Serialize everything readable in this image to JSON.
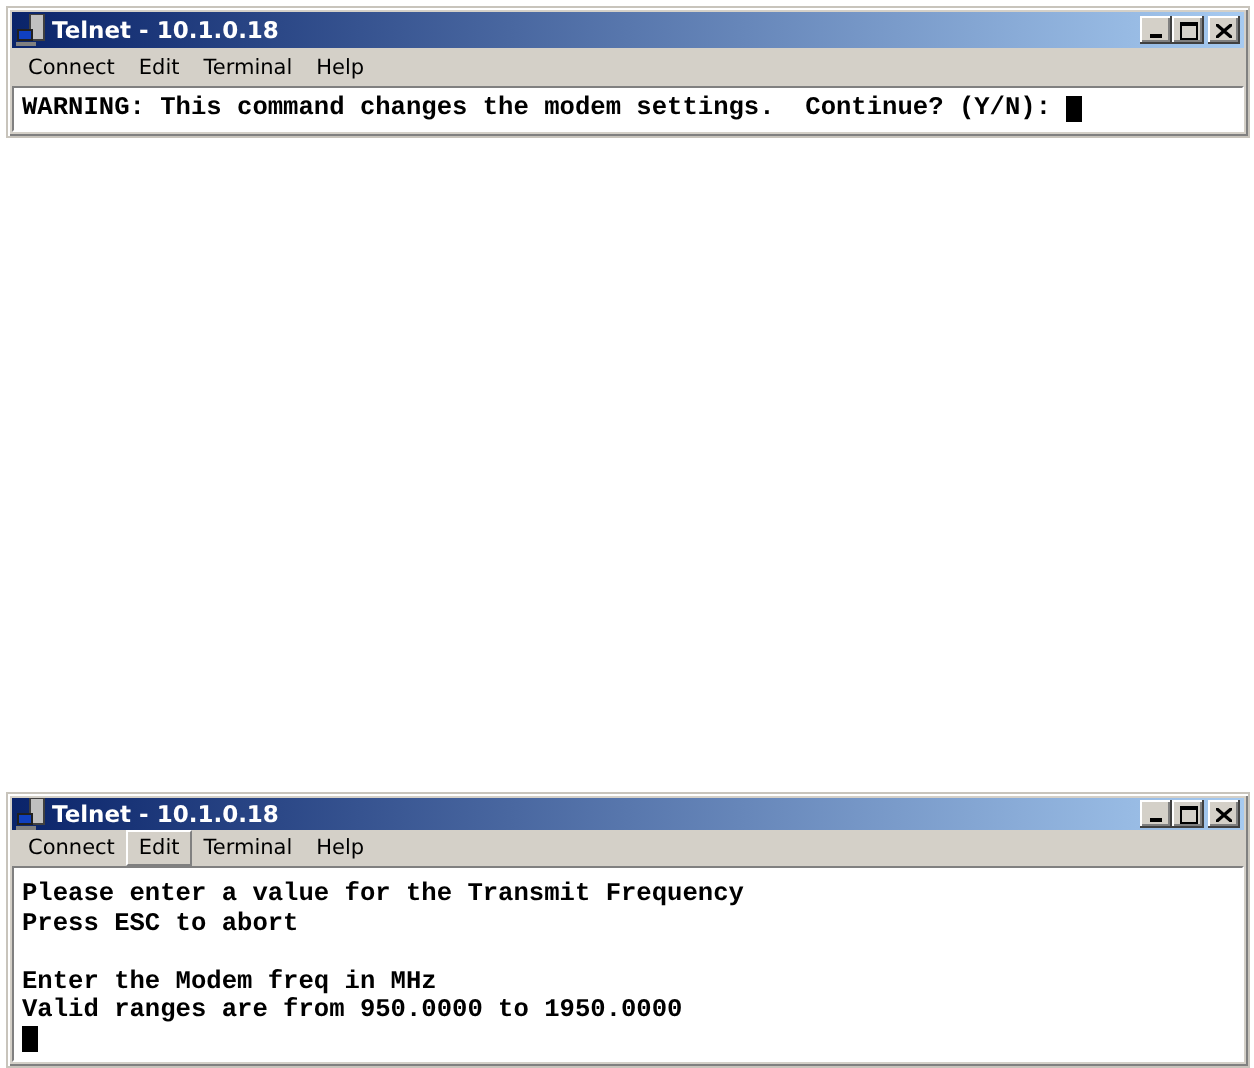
{
  "windows": [
    {
      "title": "Telnet - 10.1.0.18",
      "menu": [
        {
          "label": "Connect",
          "selected": false
        },
        {
          "label": "Edit",
          "selected": false
        },
        {
          "label": "Terminal",
          "selected": false
        },
        {
          "label": "Help",
          "selected": false
        }
      ],
      "terminal": {
        "lines": [
          {
            "kind": "text",
            "text": "WARNING: This command changes the modem settings.  Continue? (Y/N): ",
            "cursor": true
          }
        ]
      }
    },
    {
      "title": "Telnet - 10.1.0.18",
      "menu": [
        {
          "label": "Connect",
          "selected": false
        },
        {
          "label": "Edit",
          "selected": true
        },
        {
          "label": "Terminal",
          "selected": false
        },
        {
          "label": "Help",
          "selected": false
        }
      ],
      "terminal": {
        "lines": [
          {
            "kind": "text",
            "text": "Please enter a value for the Transmit Frequency",
            "cursor": false
          },
          {
            "kind": "text",
            "text": "Press ESC to abort",
            "cursor": false
          },
          {
            "kind": "blank"
          },
          {
            "kind": "text",
            "text": "Enter the Modem freq in MHz",
            "cursor": false
          },
          {
            "kind": "text",
            "text": "Valid ranges are from 950.0000 to 1950.0000",
            "cursor": false
          },
          {
            "kind": "cursor"
          }
        ]
      }
    }
  ]
}
